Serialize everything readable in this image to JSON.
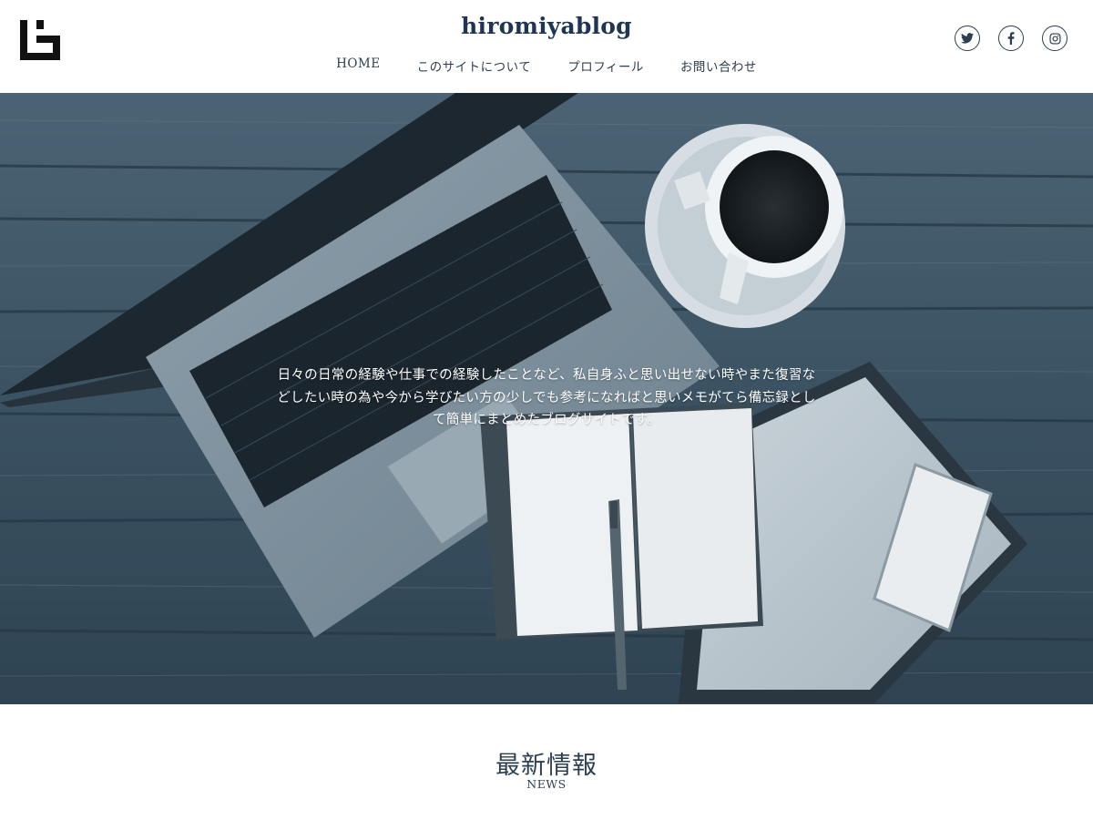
{
  "header": {
    "site_title": "hiromiyablog",
    "logo_icon": "hiromiyablog-logo-icon",
    "nav": [
      {
        "label": "HOME"
      },
      {
        "label": "このサイトについて"
      },
      {
        "label": "プロフィール"
      },
      {
        "label": "お問い合わせ"
      }
    ],
    "social": [
      {
        "icon": "twitter-icon"
      },
      {
        "icon": "facebook-icon"
      },
      {
        "icon": "instagram-icon"
      }
    ]
  },
  "hero": {
    "lines": [
      "日々の日常の経験や仕事での経験したことなど、私自身ふと思い出せない時やまた復習な",
      "どしたい時の為や今から学びたい方の少しでも参考になればと思いメモがてら備忘録とし",
      "て簡単にまとめたブログサイトです。"
    ]
  },
  "news": {
    "title": "最新情報",
    "subtitle": "NEWS"
  },
  "colors": {
    "text": "#2c3e50",
    "title": "#1f3552",
    "hero_tint": "#3d5566"
  }
}
